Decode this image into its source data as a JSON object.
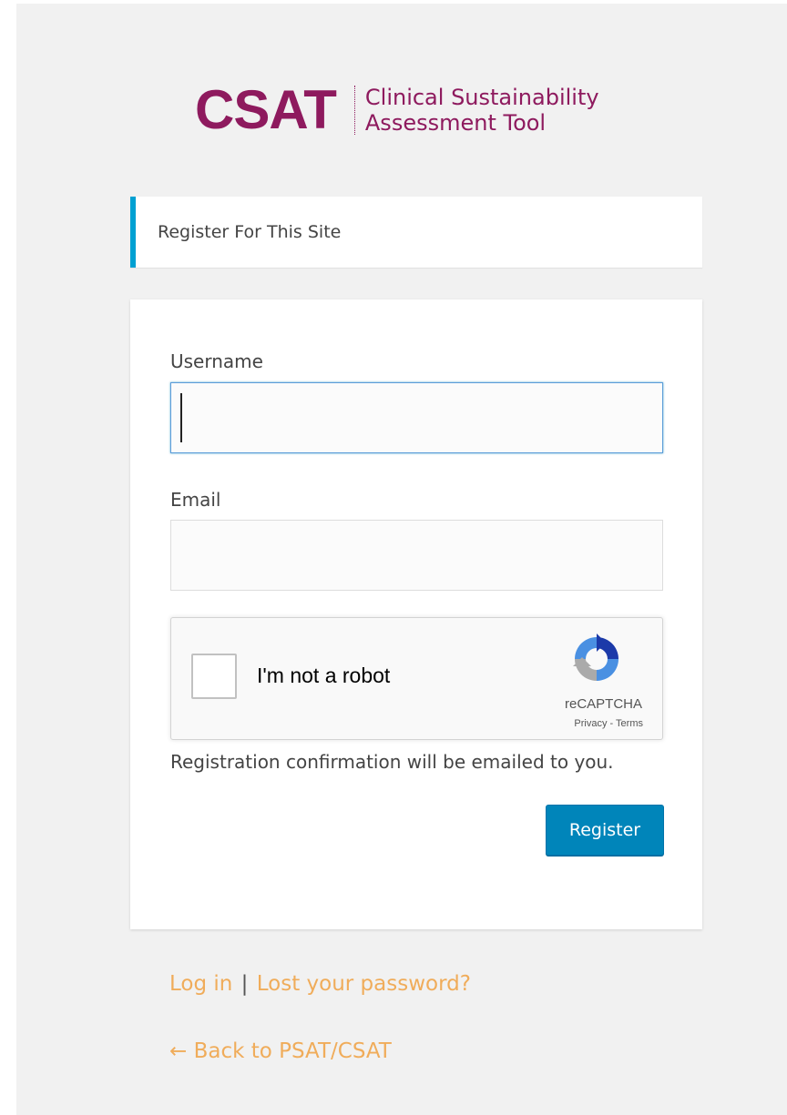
{
  "logo": {
    "mark": "CSAT",
    "sub_line1": "Clinical Sustainability",
    "sub_line2": "Assessment Tool",
    "brand_color": "#8e1a5e"
  },
  "notice": {
    "text": "Register For This Site",
    "accent_color": "#00a0d2"
  },
  "form": {
    "username_label": "Username",
    "username_value": "",
    "email_label": "Email",
    "email_value": "",
    "recaptcha": {
      "label": "I'm not a robot",
      "brand": "reCAPTCHA",
      "privacy": "Privacy",
      "separator": " - ",
      "terms": "Terms",
      "icon": "recaptcha-logo-icon"
    },
    "message": "Registration confirmation will be emailed to you.",
    "submit_label": "Register",
    "button_color": "#0085ba"
  },
  "nav": {
    "login": "Log in",
    "separator": "|",
    "lost_password": "Lost your password?",
    "back": "← Back to PSAT/CSAT",
    "link_color": "#f0ac5a"
  }
}
